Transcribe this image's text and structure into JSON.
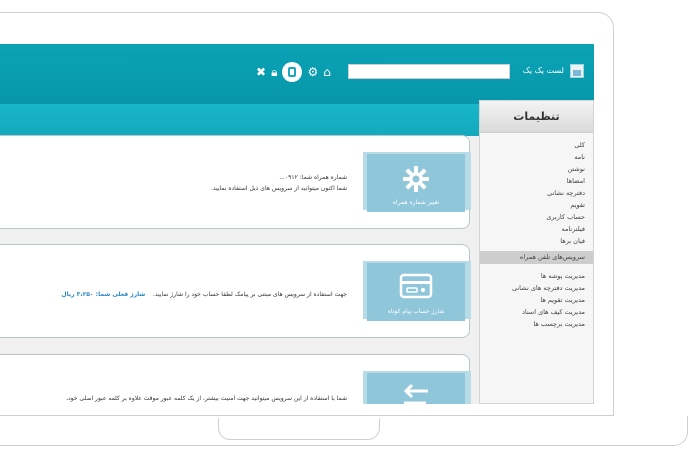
{
  "header": {
    "app_title": "لست یک یک",
    "search_value": ""
  },
  "sidebar": {
    "title": "تنظیمات",
    "items": [
      {
        "label": "کلی"
      },
      {
        "label": "نامه"
      },
      {
        "label": "نوشتن"
      },
      {
        "label": "امضاها"
      },
      {
        "label": "دفترچه نشانی"
      },
      {
        "label": "تقویم"
      },
      {
        "label": "حساب کاربری"
      },
      {
        "label": "فیلترنامه"
      },
      {
        "label": "فیان برها"
      },
      {
        "label": "سرویس‌های تلفن همراه",
        "active": true
      },
      {
        "label": "مدیریت پوشه ها"
      },
      {
        "label": "مدیریت دفترچه های نشانی"
      },
      {
        "label": "مدیریت تقویم ها"
      },
      {
        "label": "مدیریت کیف های اسناد"
      },
      {
        "label": "مدیریت برچسب ها"
      }
    ]
  },
  "cards": [
    {
      "tile_label": "تغییر شماره همراه",
      "line1": "شماره همراه شما:    ۰۹۱۲...",
      "line2": "شما اکنون میتوانید از سرویس های ذیل استفاده نمایید."
    },
    {
      "tile_label": "شارژ حساب پیام کوتاه",
      "line1": "جهت استفاده از سرویس های مبتنی بر پیامک لطفا حساب خود را شارژ نمایید.",
      "charge_label": "شارژ فعلی شما: ۳،۲۵۰ ریال"
    },
    {
      "tile_label": "",
      "line1": "شما با استفاده از این سرویس میتوانید جهت امنیت بیشتر، از یک کلمه عبور موقت علاوه بر کلمه عبور اصلی خود،"
    }
  ],
  "colors": {
    "header": "#0aa3b5",
    "subheader": "#19b7c9",
    "tile": "#8fc6da",
    "accent_text": "#2a88c7"
  }
}
